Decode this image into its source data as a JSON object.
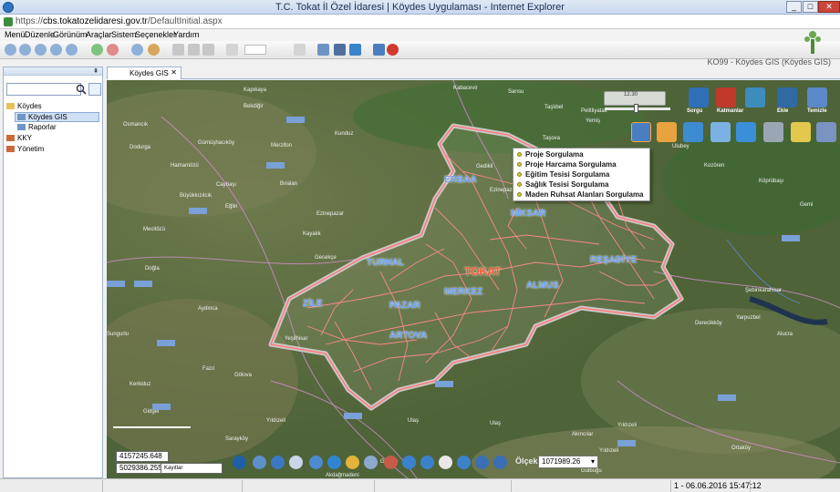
{
  "window": {
    "title": "T.C. Tokat İl Özel İdaresi | Köydes Uygulaması - Internet Explorer",
    "url_prefix": "https://",
    "url_host": "cbs.tokatozelidaresi.gov.tr",
    "url_path": "/DefaultInitial.aspx",
    "min_label": "_",
    "max_label": "□",
    "close_label": "✕"
  },
  "menu": {
    "items": [
      "Menü",
      "Düzenle",
      "Görünüm",
      "Araçlar",
      "Sistem",
      "Seçenekler",
      "Yardım"
    ]
  },
  "app_title": "KO99 - Köydes GIS (Köydes GIS)",
  "sidebar": {
    "pin": "⇞",
    "tree": [
      {
        "label": "Köydes",
        "level": 0
      },
      {
        "label": "Köydes GIS",
        "level": 1,
        "selected": true
      },
      {
        "label": "Raporlar",
        "level": 1
      },
      {
        "label": "KKY",
        "level": 0
      },
      {
        "label": "Yönetim",
        "level": 0
      }
    ]
  },
  "tab": {
    "label": "Köydes GIS",
    "close": "✕"
  },
  "context_menu": {
    "items": [
      "Proje Sorgulama",
      "Proje Harcama Sorgulama",
      "Eğitim Tesisi Sorgulama",
      "Sağlık Tesisi Sorgulama",
      "Maden Ruhsat Alanları Sorgulama"
    ]
  },
  "map": {
    "main_city": "TOKAT",
    "districts": [
      "ERBAA",
      "NİKSAR",
      "TURHAL",
      "REŞADİYE",
      "ZİLE",
      "PAZAR",
      "MERKEZ",
      "ALMUS",
      "ARTOVA"
    ],
    "coord_x": "4157245.648",
    "coord_y": "5029386.255",
    "coord_note": "Kayıtlar",
    "scale_label": "Ölçek:",
    "scale_value": "1071989.26",
    "scale_arrow": "▾",
    "zoom_label": "12.30",
    "tool_label_1": "Sorgu",
    "tool_label_2": "Katmanlar",
    "tool_label_3": "Ekle",
    "tool_label_4": "Temizle"
  },
  "status": {
    "text": "1 - 06.06.2016 15:47:12"
  },
  "colors": {
    "province_outline": "#ff8a8a",
    "titlebar": "#c8d8ee",
    "selection": "#cfe0f5",
    "district_label": "#6aa0ff",
    "city_label": "#ff5a2e"
  }
}
